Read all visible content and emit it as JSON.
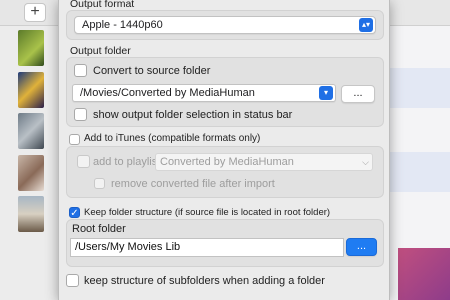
{
  "background_app": {
    "add_button_label": "+"
  },
  "preferences": {
    "output_format": {
      "heading": "Output format",
      "selected": "Apple - 1440p60"
    },
    "output_folder": {
      "heading": "Output folder",
      "convert_to_source_label": "Convert to source folder",
      "convert_to_source_checked": false,
      "path": "/Movies/Converted by MediaHuman",
      "browse_label": "...",
      "show_in_status_bar_label": "show output folder selection in status bar",
      "show_in_status_bar_checked": false
    },
    "itunes": {
      "add_to_itunes_label": "Add to iTunes (compatible formats only)",
      "add_to_itunes_checked": false,
      "add_to_playlist_label": "add to playlist:",
      "add_to_playlist_checked": false,
      "playlist_value": "Converted by MediaHuman",
      "remove_after_import_label": "remove converted file after import",
      "remove_after_import_checked": false
    },
    "folder_structure": {
      "keep_structure_label": "Keep folder structure (if source file is located in root folder)",
      "keep_structure_checked": true,
      "root_folder_heading": "Root folder",
      "root_folder_path": "/Users/My Movies Lib",
      "browse_label": "...",
      "keep_subfolders_label": "keep structure of subfolders when adding a folder",
      "keep_subfolders_checked": false
    }
  },
  "colors": {
    "accent": "#1f6fe5",
    "sheet_background": "#ebebeb"
  }
}
